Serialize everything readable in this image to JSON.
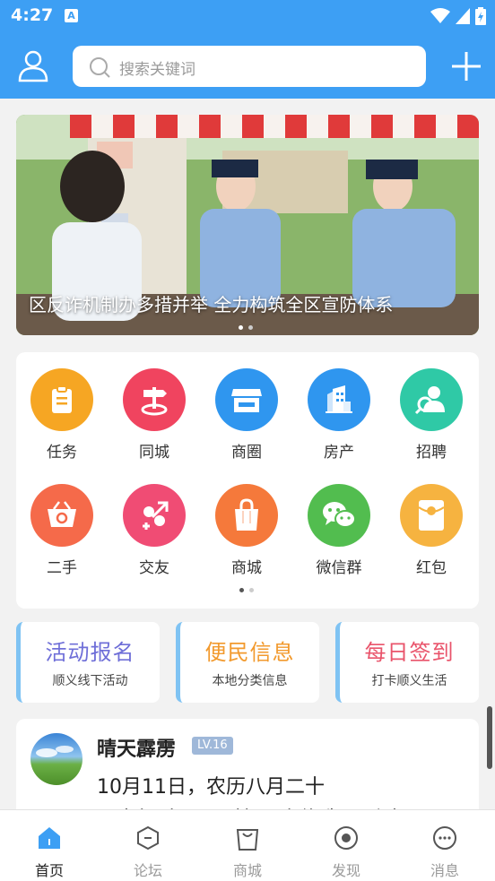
{
  "status": {
    "time": "4:27",
    "notif_glyph": "A"
  },
  "header": {
    "search_placeholder": "搜索关键词",
    "avatar_icon": "user-icon",
    "plus_icon": "plus-icon"
  },
  "banner": {
    "caption": "区反诈机制办多措并举 全力构筑全区宣防体系",
    "active_index": 0,
    "count": 2
  },
  "grid": {
    "items": [
      {
        "label": "任务",
        "icon": "clipboard-icon",
        "color": "#f6a623"
      },
      {
        "label": "同城",
        "icon": "signpost-icon",
        "color": "#f0445f"
      },
      {
        "label": "商圈",
        "icon": "storefront-icon",
        "color": "#2f96ef"
      },
      {
        "label": "房产",
        "icon": "building-icon",
        "color": "#2f96ef"
      },
      {
        "label": "招聘",
        "icon": "recruit-icon",
        "color": "#2fc9a6"
      },
      {
        "label": "二手",
        "icon": "basket-icon",
        "color": "#f56a4a"
      },
      {
        "label": "交友",
        "icon": "gender-icon",
        "color": "#f04c74"
      },
      {
        "label": "商城",
        "icon": "shopping-bag-icon",
        "color": "#f5793b"
      },
      {
        "label": "微信群",
        "icon": "wechat-icon",
        "color": "#52bd4f"
      },
      {
        "label": "红包",
        "icon": "red-envelope-icon",
        "color": "#f6b340"
      }
    ],
    "page_active": 0,
    "page_count": 2
  },
  "quick": [
    {
      "title": "活动报名",
      "sub": "顺义线下活动",
      "color": "#6f6fd8"
    },
    {
      "title": "便民信息",
      "sub": "本地分类信息",
      "color": "#f29a2e"
    },
    {
      "title": "每日签到",
      "sub": "打卡顺义生活",
      "color": "#e9546b"
    }
  ],
  "post": {
    "name": "晴天霹雳",
    "level": "LV.16",
    "line1": "10月11日，农历八月二十",
    "line2": "忌出行 宜 顺 忌嫁娶 宜修造 忌动土"
  },
  "tabs": [
    {
      "label": "首页",
      "icon": "home-icon",
      "active": true
    },
    {
      "label": "论坛",
      "icon": "forum-icon",
      "active": false
    },
    {
      "label": "商城",
      "icon": "shopping-bag-icon",
      "active": false
    },
    {
      "label": "发现",
      "icon": "discover-icon",
      "active": false
    },
    {
      "label": "消息",
      "icon": "message-icon",
      "active": false
    }
  ]
}
